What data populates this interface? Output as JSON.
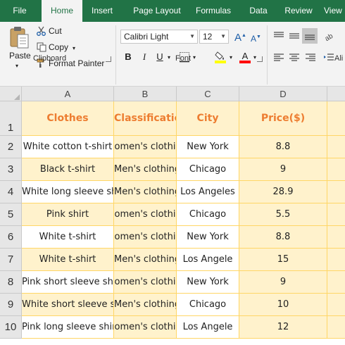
{
  "menu": {
    "tabs": [
      "File",
      "Home",
      "Insert",
      "Page Layout",
      "Formulas",
      "Data",
      "Review",
      "View"
    ],
    "active": "Home"
  },
  "ribbon": {
    "clipboard": {
      "paste": "Paste",
      "cut": "Cut",
      "copy": "Copy",
      "format_painter": "Format Painter",
      "group_label": "Clipboard"
    },
    "font": {
      "font_name": "Calibri Light",
      "font_size": "12",
      "group_label": "Font",
      "bold": "B",
      "italic": "I",
      "underline": "U",
      "grow": "A",
      "shrink": "A",
      "font_color_accent": "#ff0000",
      "highlight_accent": "#ffff00"
    },
    "alignment": {
      "group_label": "Ali"
    }
  },
  "sheet": {
    "columns": [
      "A",
      "B",
      "C",
      "D"
    ],
    "headers": [
      "Clothes",
      "Classification",
      "City",
      "Price($)"
    ],
    "rows": [
      {
        "num": "1"
      },
      {
        "num": "2",
        "clothes": "White cotton t-shirt",
        "classification": "omen's clothi",
        "city": "New York",
        "price": "8.8"
      },
      {
        "num": "3",
        "clothes": "Black t-shirt",
        "classification": "Men's clothing",
        "city": "Chicago",
        "price": "9"
      },
      {
        "num": "4",
        "clothes": "White long sleeve shi",
        "classification": "Men's clothing",
        "city": "Los Angeles",
        "price": "28.9"
      },
      {
        "num": "5",
        "clothes": "Pink shirt",
        "classification": "omen's clothi",
        "city": "Chicago",
        "price": "5.5"
      },
      {
        "num": "6",
        "clothes": "White t-shirt",
        "classification": "omen's clothi",
        "city": "New York",
        "price": "8.8"
      },
      {
        "num": "7",
        "clothes": "White t-shirt",
        "classification": "Men's clothing",
        "city": "Los Angele",
        "price": "15"
      },
      {
        "num": "8",
        "clothes": "Pink short sleeve shir",
        "classification": "omen's clothi",
        "city": "New York",
        "price": "9"
      },
      {
        "num": "9",
        "clothes": "White short sleeve sh",
        "classification": "Men's clothing",
        "city": "Chicago",
        "price": "10"
      },
      {
        "num": "10",
        "clothes": "Pink long sleeve shir",
        "classification": "omen's clothi",
        "city": "Los Angele",
        "price": "12"
      }
    ],
    "header_color": "#ed7d31",
    "fill_color": "#fff2cc"
  }
}
